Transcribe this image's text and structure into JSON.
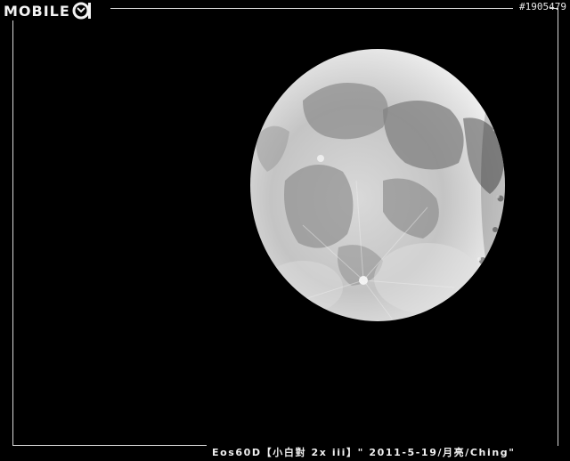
{
  "watermark": {
    "brand": "MOBILE01",
    "logo_text": "MOBILE",
    "logo_mark_icon": "mobile01-01-logo-icon"
  },
  "photo": {
    "id": "#1905479",
    "caption": "Eos60D【小白對 2x iii】\" 2011-5-19/月亮/Ching\"",
    "subject": "moon"
  },
  "colors": {
    "background": "#000000",
    "frame_line": "#d8d8d8",
    "text": "#f0f0f0",
    "moon_light": "#e6e6e6",
    "moon_mid": "#b8b8b8",
    "moon_dark": "#7c7c7c"
  }
}
